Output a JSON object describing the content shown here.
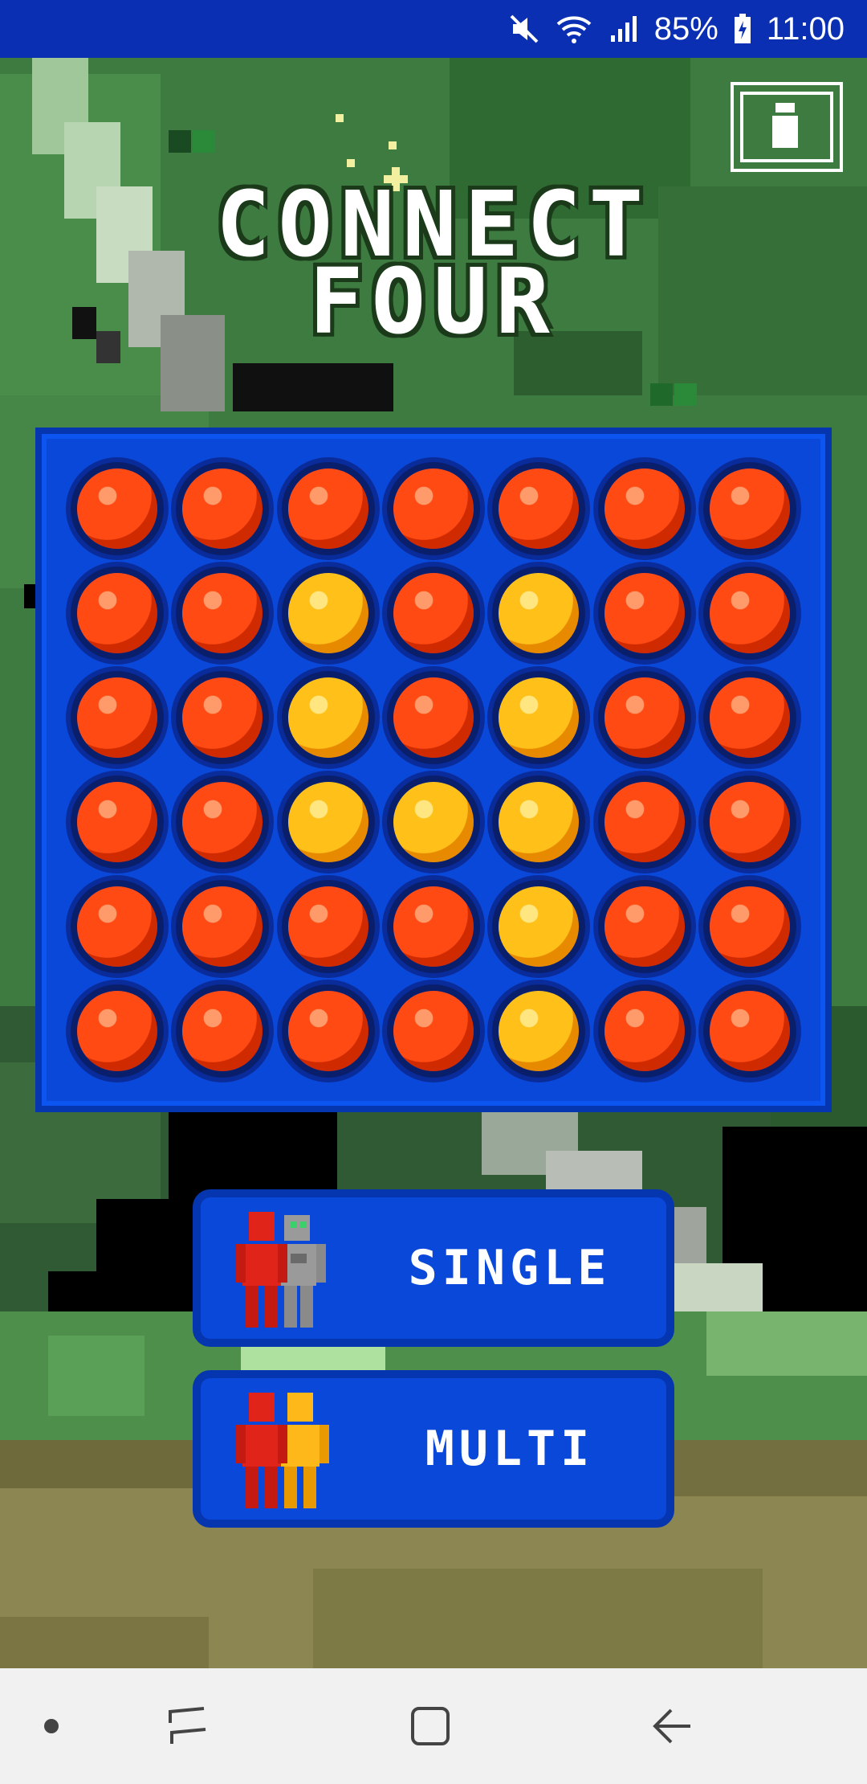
{
  "status_bar": {
    "battery_percent": "85%",
    "time": "11:00",
    "icons": [
      "mute-icon",
      "wifi-icon",
      "signal-icon",
      "battery-charging-icon"
    ]
  },
  "title": {
    "line1": "CONNECT",
    "line2": "FOUR"
  },
  "info_button": {
    "icon": "info-icon"
  },
  "board": {
    "rows": [
      [
        "red",
        "red",
        "red",
        "red",
        "red",
        "red",
        "red"
      ],
      [
        "red",
        "red",
        "yellow",
        "red",
        "yellow",
        "red",
        "red"
      ],
      [
        "red",
        "red",
        "yellow",
        "red",
        "yellow",
        "red",
        "red"
      ],
      [
        "red",
        "red",
        "yellow",
        "yellow",
        "yellow",
        "red",
        "red"
      ],
      [
        "red",
        "red",
        "red",
        "red",
        "yellow",
        "red",
        "red"
      ],
      [
        "red",
        "red",
        "red",
        "red",
        "yellow",
        "red",
        "red"
      ]
    ],
    "colors": {
      "red": "#ff4a14",
      "yellow": "#ffc01a",
      "board": "#0a48d9"
    }
  },
  "buttons": {
    "single": {
      "label": "SINGLE",
      "icon": "player-vs-robot-icon"
    },
    "multi": {
      "label": "MULTI",
      "icon": "two-players-icon"
    }
  },
  "nav_bar": {
    "icons": [
      "dot-icon",
      "recent-apps-icon",
      "home-icon",
      "back-icon"
    ]
  }
}
